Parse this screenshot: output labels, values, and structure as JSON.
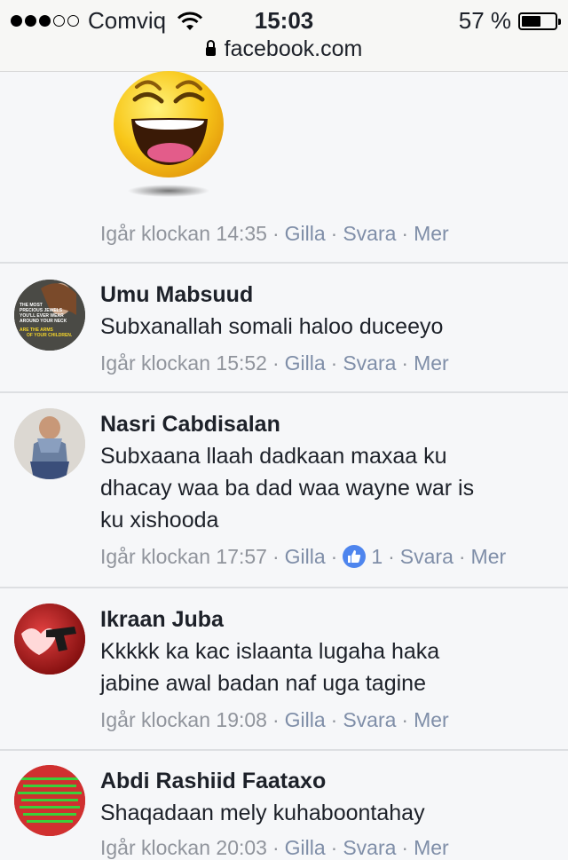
{
  "status": {
    "carrier": "Comviq",
    "time": "15:03",
    "battery": "57 %",
    "battery_level": 0.57,
    "url": "facebook.com"
  },
  "actions": {
    "like": "Gilla",
    "reply": "Svara",
    "more": "Mer",
    "sep": "·"
  },
  "first": {
    "timestamp": "Igår klockan 14:35"
  },
  "comments": [
    {
      "name": "Umu Mabsuud",
      "lines": [
        "Subxanallah somali haloo duceeyo"
      ],
      "timestamp": "Igår klockan 15:52"
    },
    {
      "name": "Nasri Cabdisalan",
      "lines": [
        "Subxaana llaah dadkaan maxaa ku",
        "dhacay waa ba dad waa wayne war is",
        "ku xishooda"
      ],
      "timestamp": "Igår klockan 17:57",
      "likes": "1"
    },
    {
      "name": "Ikraan Juba",
      "lines": [
        "Kkkkk ka kac islaanta lugaha haka",
        "jabine awal badan naf uga tagine"
      ],
      "timestamp": "Igår klockan 19:08"
    },
    {
      "name": "Abdi Rashiid Faataxo",
      "lines": [
        "Shaqadaan mely kuhaboontahay"
      ],
      "timestamp": "Igår klockan 20:03"
    }
  ],
  "avatar_text": {
    "umu": [
      "THE MOST",
      "PRECIOUS JEWELS",
      "YOU'LL EVER WEAR",
      "AROUND YOUR NECK",
      "ARE THE ARMS",
      "OF YOUR CHILDREN."
    ]
  },
  "colors": {
    "meta": "#90949c",
    "link": "#7f8ea8",
    "like": "#4e85ee",
    "divider": "#dddfe2",
    "background": "#f6f7f9"
  }
}
